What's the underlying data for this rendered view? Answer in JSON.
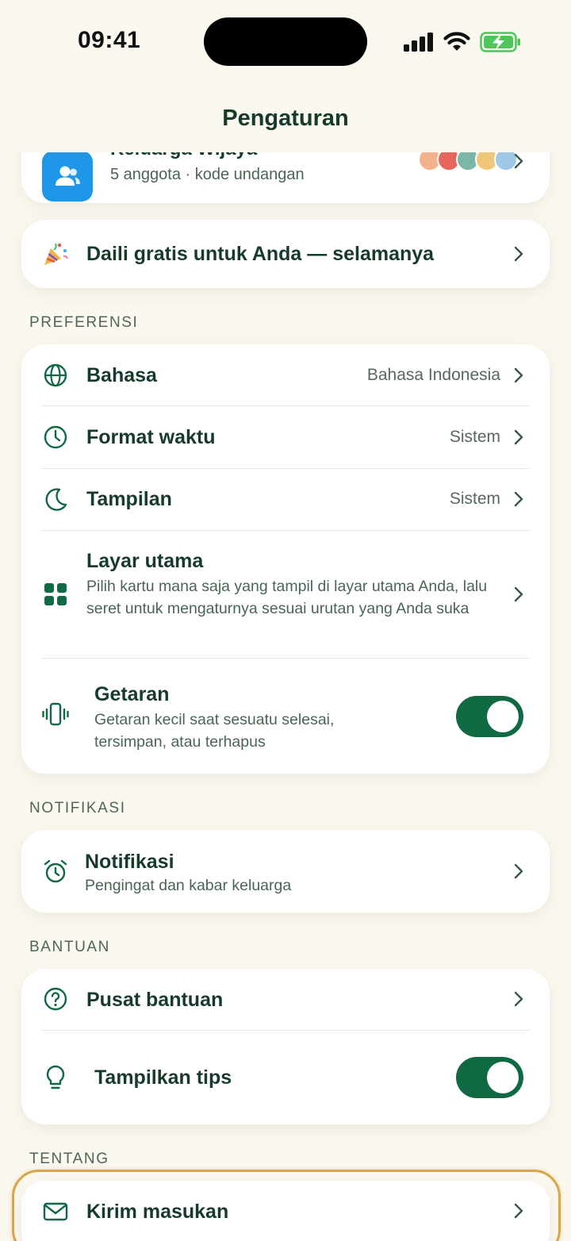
{
  "status_bar": {
    "time": "09:41"
  },
  "header": {
    "title": "Pengaturan"
  },
  "family": {
    "name": "Keluarga Wijaya",
    "subtitle": "5 anggota · kode undangan"
  },
  "promo": {
    "label": "Daili gratis untuk Anda — selamanya"
  },
  "sections": {
    "preferences": {
      "label": "PREFERENSI",
      "language": {
        "title": "Bahasa",
        "value": "Bahasa Indonesia"
      },
      "time_format": {
        "title": "Format waktu",
        "value": "Sistem"
      },
      "appearance": {
        "title": "Tampilan",
        "value": "Sistem"
      },
      "home_screen": {
        "title": "Layar utama",
        "subtitle": "Pilih kartu mana saja yang tampil di layar utama Anda, lalu seret untuk mengaturnya sesuai urutan yang Anda suka"
      },
      "haptics": {
        "title": "Getaran",
        "subtitle": "Getaran kecil saat sesuatu selesai, tersimpan, atau terhapus",
        "enabled": true
      }
    },
    "notifications": {
      "label": "NOTIFIKASI",
      "notifications": {
        "title": "Notifikasi",
        "subtitle": "Pengingat dan kabar keluarga"
      }
    },
    "help": {
      "label": "BANTUAN",
      "help_center": {
        "title": "Pusat bantuan"
      },
      "show_tips": {
        "title": "Tampilkan tips",
        "enabled": true
      }
    },
    "about": {
      "label": "TENTANG",
      "feedback": {
        "title": "Kirim masukan"
      }
    }
  },
  "colors": {
    "accent": "#0f6a44",
    "background": "#fbf8f0",
    "text": "#163b2a",
    "highlight": "#d9a545",
    "family_icon": "#1f97e8"
  }
}
